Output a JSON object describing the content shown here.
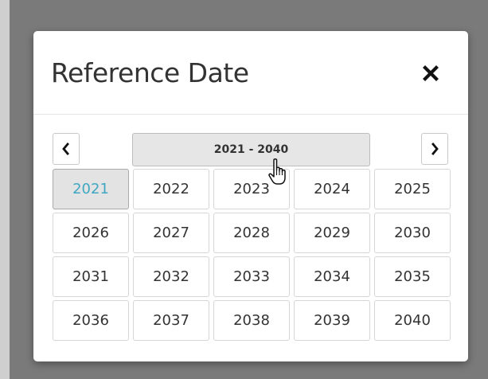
{
  "modal": {
    "title": "Reference Date",
    "close_icon": "close-icon"
  },
  "picker": {
    "prev_icon": "chevron-left-icon",
    "next_icon": "chevron-right-icon",
    "range_label": "2021 - 2040",
    "years": [
      {
        "label": "2021",
        "selected": true
      },
      {
        "label": "2022",
        "selected": false
      },
      {
        "label": "2023",
        "selected": false
      },
      {
        "label": "2024",
        "selected": false
      },
      {
        "label": "2025",
        "selected": false
      },
      {
        "label": "2026",
        "selected": false
      },
      {
        "label": "2027",
        "selected": false
      },
      {
        "label": "2028",
        "selected": false
      },
      {
        "label": "2029",
        "selected": false
      },
      {
        "label": "2030",
        "selected": false
      },
      {
        "label": "2031",
        "selected": false
      },
      {
        "label": "2032",
        "selected": false
      },
      {
        "label": "2033",
        "selected": false
      },
      {
        "label": "2034",
        "selected": false
      },
      {
        "label": "2035",
        "selected": false
      },
      {
        "label": "2036",
        "selected": false
      },
      {
        "label": "2037",
        "selected": false
      },
      {
        "label": "2038",
        "selected": false
      },
      {
        "label": "2039",
        "selected": false
      },
      {
        "label": "2040",
        "selected": false
      }
    ]
  },
  "colors": {
    "selected_year_text": "#3fa7c2",
    "backdrop": "#7a7a7a"
  },
  "cursor_icon": "hand-pointer-icon"
}
